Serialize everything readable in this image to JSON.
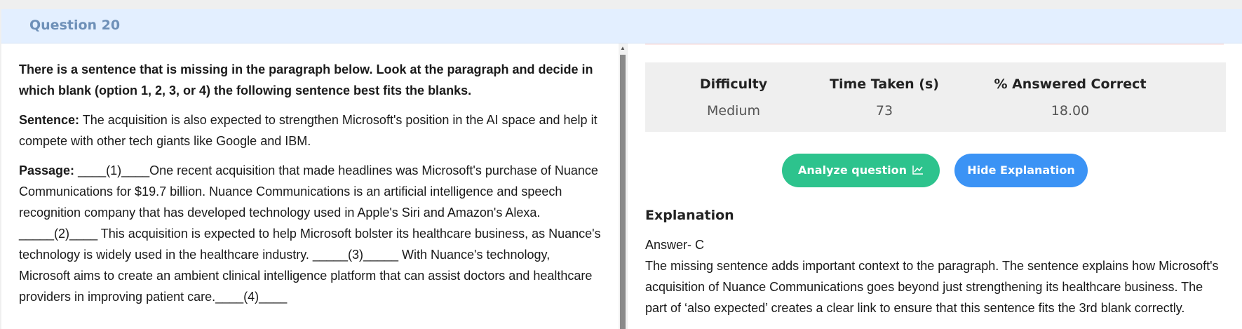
{
  "header": {
    "title": "Question 20"
  },
  "question": {
    "instruction": "There is a sentence that is missing in the paragraph below. Look at the paragraph and decide in which blank (option 1, 2, 3, or 4) the following sentence best fits the blanks.",
    "sentence_label": "Sentence:",
    "sentence_text": " The acquisition is also expected to strengthen Microsoft's position in the AI space and help it compete with other tech giants like Google and IBM.",
    "passage_label": "Passage:",
    "passage_text": " ____(1)____One recent acquisition that made headlines was Microsoft's purchase of Nuance Communications for $19.7 billion. Nuance Communications is an artificial intelligence and speech recognition company that has developed technology used in Apple's Siri and Amazon's Alexa. _____(2)____ This acquisition is expected to help Microsoft bolster its healthcare business, as Nuance's technology is widely used in the healthcare industry. _____(3)_____ With Nuance's technology, Microsoft aims to create an ambient clinical intelligence platform that can assist doctors and healthcare providers in improving patient care.____(4)____"
  },
  "stats": {
    "difficulty_label": "Difficulty",
    "difficulty_value": "Medium",
    "time_label": "Time Taken (s)",
    "time_value": "73",
    "correct_label": "% Answered Correct",
    "correct_value": "18.00"
  },
  "buttons": {
    "analyze_label": "Analyze question",
    "analyze_icon": "chart-line-icon",
    "hide_label": "Hide Explanation"
  },
  "explanation": {
    "title": "Explanation",
    "answer": "Answer- C",
    "text": "The missing sentence adds important context to the paragraph. The sentence explains how Microsoft's acquisition of Nuance Communications goes beyond just strengthening its healthcare business. The part of ‘also expected’ creates a clear link to ensure that this sentence fits the 3rd blank correctly."
  },
  "colors": {
    "header_bg": "#e3efff",
    "header_text": "#6e90b8",
    "analyze_bg": "#2dc38d",
    "hide_bg": "#3b93f5"
  }
}
